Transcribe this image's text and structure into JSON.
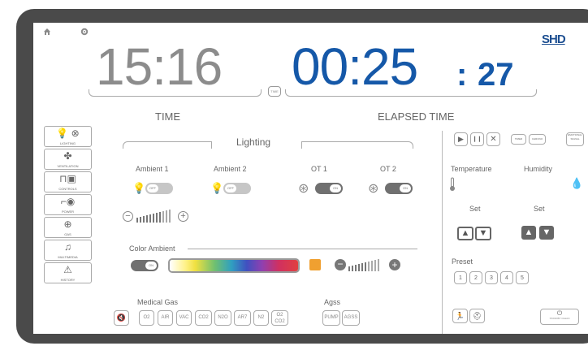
{
  "header": {
    "home_icon": "home-icon",
    "settings_icon": "gear-icon",
    "logo": "SHD"
  },
  "clock": {
    "time": "15:16",
    "time_caption": "TIME",
    "elapsed": "00:25",
    "elapsed_sep": ":",
    "elapsed_seconds": "27",
    "elapsed_caption": "ELAPSED TIME",
    "reset_label": "TIME"
  },
  "sidebar": {
    "items": [
      {
        "label": "LIGHTING",
        "icon": "bulb-icon"
      },
      {
        "label": "VENTILATION",
        "icon": "fan-icon"
      },
      {
        "label": "CONTROLS",
        "icon": "controls-icon"
      },
      {
        "label": "POWER",
        "icon": "plug-icon"
      },
      {
        "label": "GAS",
        "icon": "gas-icon"
      },
      {
        "label": "MULTIMEDIA",
        "icon": "music-icon"
      },
      {
        "label": "HISTORY",
        "icon": "warning-icon"
      }
    ]
  },
  "lighting": {
    "title": "Lighting",
    "ambient1": "Ambient 1",
    "ambient2": "Ambient 2",
    "ot1": "OT 1",
    "ot2": "OT 2",
    "toggle_off": "OFF",
    "toggle_on": "ON",
    "color_ambient": "Color Ambient"
  },
  "timer": {
    "buttons": [
      "▶",
      "❙❙",
      "✕"
    ],
    "small1": "TIMER",
    "small2": "CHRONO",
    "small3": "EMOTIONAL SIGNAL"
  },
  "climate": {
    "temperature": "Temperature",
    "humidity": "Humidity",
    "set1": "Set",
    "set2": "Set",
    "preset": "Preset",
    "presets": [
      "1",
      "2",
      "3",
      "4",
      "5"
    ]
  },
  "medical_gas": {
    "title": "Medical Gas",
    "items": [
      "O2",
      "AIR",
      "VAC",
      "CO2",
      "N2O",
      "AR7",
      "N2",
      "O2 CO2"
    ]
  },
  "agss": {
    "title": "Agss",
    "items": [
      "PUMP",
      "AGSS"
    ]
  },
  "footer": {
    "standby": "STANDBY CLEAN"
  },
  "colors": {
    "bezel": "#4a4a4a",
    "elapsed": "#1558a8",
    "time": "#8c8c8c",
    "orange": "#f0a030"
  }
}
